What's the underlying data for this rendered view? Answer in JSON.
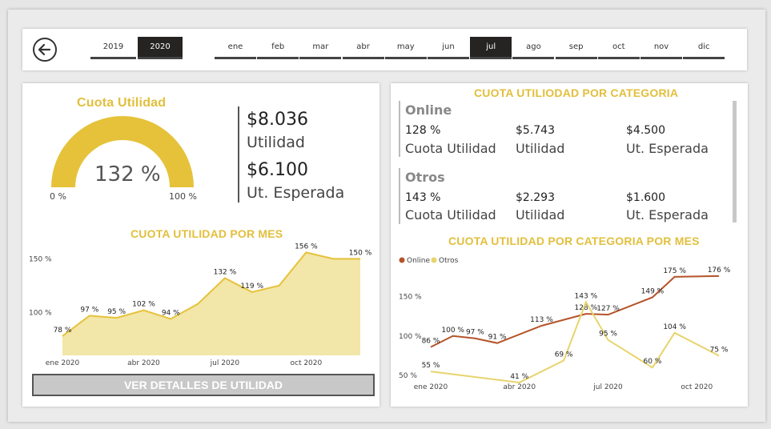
{
  "years": [
    "2019",
    "2020"
  ],
  "selected_year": "2020",
  "months": [
    "ene",
    "feb",
    "mar",
    "abr",
    "may",
    "jun",
    "jul",
    "ago",
    "sep",
    "oct",
    "nov",
    "dic"
  ],
  "selected_month": "jul",
  "gauge": {
    "title": "Cuota Utilidad",
    "value_label": "132 %",
    "value": 132,
    "min_label": "0 %",
    "max_label": "100 %"
  },
  "kpis": {
    "utilidad_value": "$8.036",
    "utilidad_label": "Utilidad",
    "esperada_value": "$6.100",
    "esperada_label": "Ut. Esperada"
  },
  "categories_title": "CUOTA UTILIODAD POR CATEGORIA",
  "categories": [
    {
      "name": "Online",
      "cuota": "128 %",
      "cuota_label": "Cuota Utilidad",
      "utilidad": "$5.743",
      "utilidad_label": "Utilidad",
      "esperada": "$4.500",
      "esperada_label": "Ut. Esperada"
    },
    {
      "name": "Otros",
      "cuota": "143 %",
      "cuota_label": "Cuota Utilidad",
      "utilidad": "$2.293",
      "utilidad_label": "Utilidad",
      "esperada": "$1.600",
      "esperada_label": "Ut. Esperada"
    }
  ],
  "button_label": "VER DETALLES DE UTILIDAD",
  "colors": {
    "gold": "#e6c23a",
    "area": "#f2e6a8",
    "online": "#b5532a",
    "otros": "#e8d46c"
  },
  "chart_data": [
    {
      "type": "area",
      "title": "CUOTA UTILIDAD POR MES",
      "x": [
        "ene 2020",
        "feb 2020",
        "mar 2020",
        "abr 2020",
        "may 2020",
        "jun 2020",
        "jul 2020",
        "ago 2020",
        "sep 2020",
        "oct 2020",
        "nov 2020",
        "dic 2020"
      ],
      "values": [
        78,
        97,
        95,
        102,
        94,
        108,
        132,
        119,
        125,
        156,
        150,
        150
      ],
      "data_labels": [
        {
          "i": 0,
          "t": "78 %"
        },
        {
          "i": 1,
          "t": "97 %"
        },
        {
          "i": 2,
          "t": "95 %"
        },
        {
          "i": 3,
          "t": "102 %"
        },
        {
          "i": 4,
          "t": "94 %"
        },
        {
          "i": 6,
          "t": "132 %"
        },
        {
          "i": 7,
          "t": "119 %"
        },
        {
          "i": 9,
          "t": "156 %"
        },
        {
          "i": 11,
          "t": "150 %"
        }
      ],
      "x_ticks": [
        "ene 2020",
        "abr 2020",
        "jul 2020",
        "oct 2020"
      ],
      "y_ticks": [
        "150 %",
        "100 %"
      ],
      "ylim": [
        60,
        160
      ]
    },
    {
      "type": "line",
      "title": "CUOTA UTILIDAD POR CATEGORIA POR MES",
      "x": [
        "ene 2020",
        "feb 2020",
        "mar 2020",
        "abr 2020",
        "may 2020",
        "jun 2020",
        "jul 2020",
        "ago 2020",
        "sep 2020",
        "oct 2020",
        "nov 2020",
        "dic 2020"
      ],
      "series": [
        {
          "name": "Online",
          "values": [
            86,
            100,
            97,
            91,
            113,
            128,
            127,
            149,
            175,
            176
          ],
          "labels": [
            "86 %",
            "100 %",
            "97 %",
            "91 %",
            "113 %",
            "128 %",
            "127 %",
            "149 %",
            "175 %",
            "176 %"
          ],
          "xi": [
            0,
            1,
            2,
            3,
            5,
            7,
            8,
            10,
            11,
            13
          ]
        },
        {
          "name": "Otros",
          "values": [
            55,
            41,
            69,
            143,
            95,
            60,
            104,
            75
          ],
          "labels": [
            "55 %",
            "41 %",
            "69 %",
            "143 %",
            "95 %",
            "60 %",
            "104 %",
            "75 %"
          ],
          "xi": [
            0,
            4,
            6,
            7,
            8,
            10,
            11,
            13
          ]
        }
      ],
      "x_ticks": [
        "ene 2020",
        "abr 2020",
        "jul 2020",
        "oct 2020"
      ],
      "y_ticks": [
        "150 %",
        "100 %",
        "50 %"
      ],
      "ylim": [
        45,
        185
      ]
    }
  ]
}
